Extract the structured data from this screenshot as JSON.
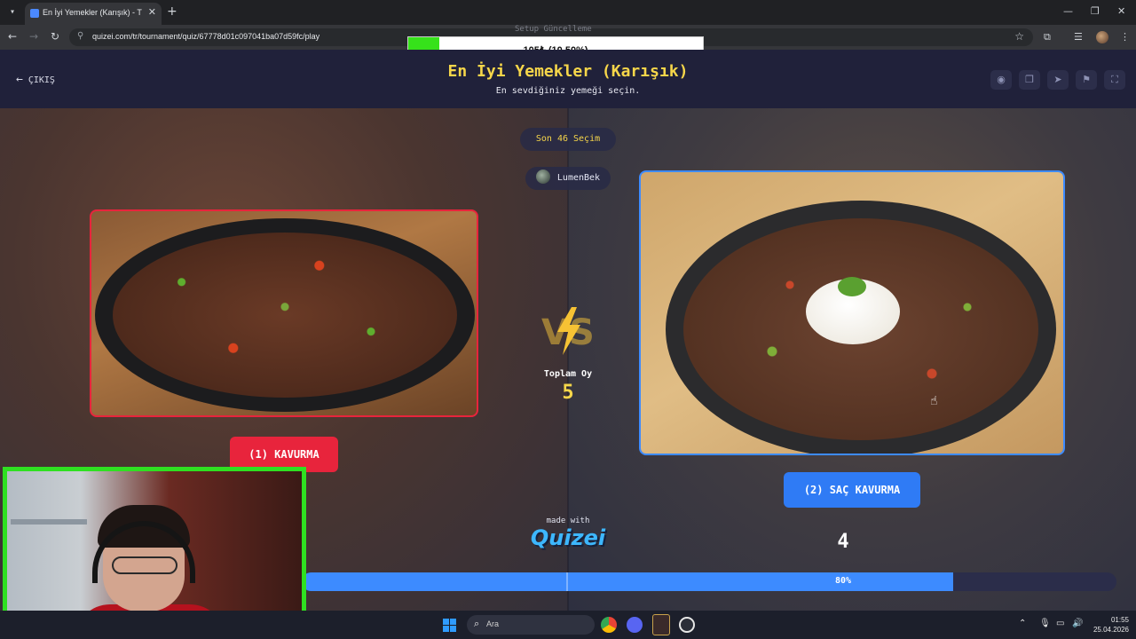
{
  "browser": {
    "tab_title": "En İyi Yemekler (Karışık) - Tier L",
    "url": "quizei.com/tr/tournament/quiz/67778d01c097041ba07d59fc/play"
  },
  "overlay": {
    "label": "Setup Güncelleme",
    "progress_text": "105₺ (10.50%)",
    "progress_fraction": 0.105,
    "fill_color": "#36e21a"
  },
  "header": {
    "exit_label": "ÇIKIŞ",
    "title": "En İyi Yemekler (Karışık)",
    "subtitle": "En sevdiğiniz yemeği seçin.",
    "title_color": "#f6d64a",
    "icons": [
      "eye-icon",
      "copy-icon",
      "send-icon",
      "flag-icon",
      "fullscreen-icon"
    ]
  },
  "match": {
    "round_label": "Son 46 Seçim",
    "username": "LumenBek",
    "total_votes_label": "Toplam Oy",
    "total_votes": "5",
    "left_choice": "(1) KAVURMA",
    "right_choice": "(2) SAÇ KAVURMA",
    "left_color": "#e8243c",
    "right_color": "#2f7bf5",
    "right_votes": "4",
    "result_percent_label": "80%",
    "result_fraction": 0.8
  },
  "footer": {
    "made_with": "made with",
    "brand": "Quizei"
  },
  "taskbar": {
    "search_placeholder": "Ara",
    "time": "01:55",
    "date": "25.04.2026"
  }
}
